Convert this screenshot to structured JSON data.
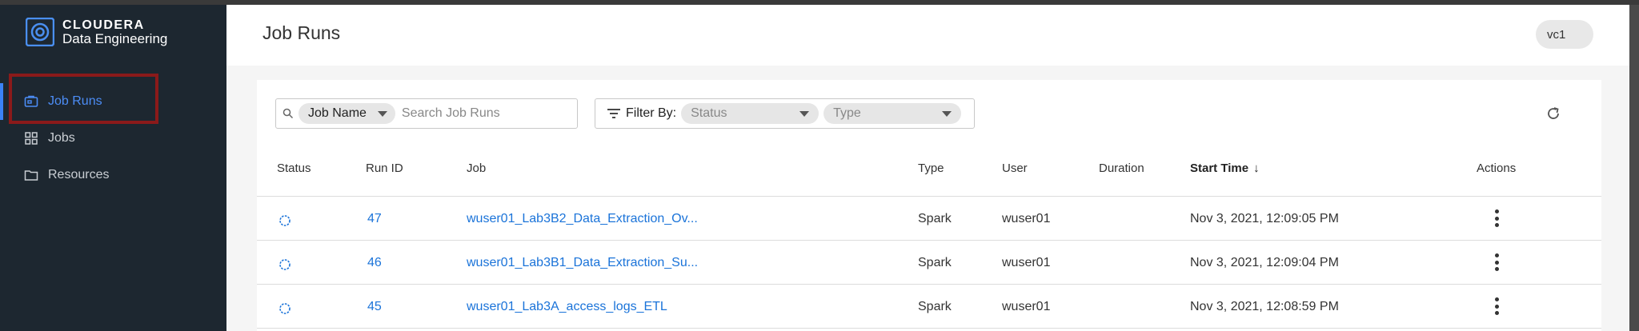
{
  "brand": {
    "name": "CLOUDERA",
    "product": "Data Engineering"
  },
  "sidebar": {
    "items": [
      {
        "label": "Job Runs",
        "icon": "job-runs-icon",
        "active": true
      },
      {
        "label": "Jobs",
        "icon": "grid-icon",
        "active": false
      },
      {
        "label": "Resources",
        "icon": "folder-icon",
        "active": false
      }
    ]
  },
  "header": {
    "title": "Job Runs",
    "vc": "vc1"
  },
  "search": {
    "field_label": "Job Name",
    "placeholder": "Search Job Runs"
  },
  "filter": {
    "label": "Filter By:",
    "status_placeholder": "Status",
    "type_placeholder": "Type"
  },
  "table": {
    "columns": [
      "Status",
      "Run ID",
      "Job",
      "Type",
      "User",
      "Duration",
      "Start Time",
      "Actions"
    ],
    "sort_indicator": "↓",
    "rows": [
      {
        "run_id": "47",
        "job": "wuser01_Lab3B2_Data_Extraction_Ov...",
        "type": "Spark",
        "user": "wuser01",
        "duration": "",
        "start_time": "Nov 3, 2021, 12:09:05 PM"
      },
      {
        "run_id": "46",
        "job": "wuser01_Lab3B1_Data_Extraction_Su...",
        "type": "Spark",
        "user": "wuser01",
        "duration": "",
        "start_time": "Nov 3, 2021, 12:09:04 PM"
      },
      {
        "run_id": "45",
        "job": "wuser01_Lab3A_access_logs_ETL",
        "type": "Spark",
        "user": "wuser01",
        "duration": "",
        "start_time": "Nov 3, 2021, 12:08:59 PM"
      }
    ]
  },
  "colors": {
    "accent": "#3b82f6",
    "link": "#1a73d9",
    "sidebar_bg": "#1d2730",
    "highlight_border": "#8b1a1a"
  }
}
